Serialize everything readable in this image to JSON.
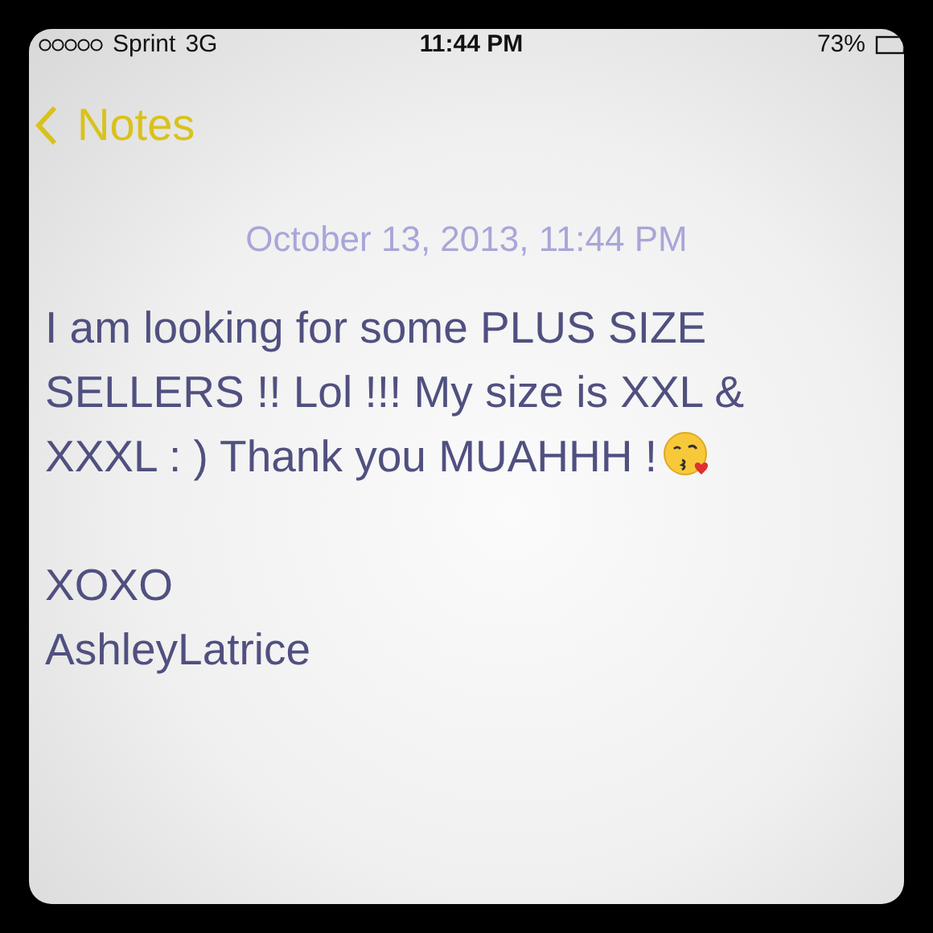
{
  "status_bar": {
    "carrier": "Sprint",
    "network": "3G",
    "time": "11:44 PM",
    "battery": "73%"
  },
  "nav": {
    "back_label": "Notes"
  },
  "note": {
    "date": "October 13, 2013, 11:44 PM",
    "paragraphs": [
      {
        "text": "I am looking for some PLUS SIZE SELLERS !! Lol !!! My size is XXL & XXXL : ) Thank you MUAHHH !",
        "trailing_emoji": true
      },
      {
        "text": "XOXO",
        "trailing_emoji": false
      },
      {
        "text": "AshleyLatrice",
        "trailing_emoji": false
      }
    ]
  }
}
